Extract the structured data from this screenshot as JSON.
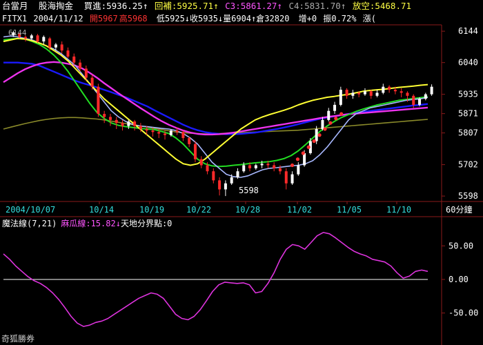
{
  "header": {
    "instrument": "台當月",
    "tool_name": "股海掏金",
    "bid_label": "買進:",
    "bid_value": "5936.25",
    "bid_arrow": "↑",
    "support_label": "回補:",
    "support_value": "5925.71",
    "support_arrow": "↑",
    "c3_label": "C3:",
    "c3_value": "5861.27",
    "c3_arrow": "↑",
    "c4_label": "C4:",
    "c4_value": "5831.70",
    "c4_arrow": "↑",
    "short_label": "放空:",
    "short_value": "5468.71",
    "extra": "漲("
  },
  "quote": {
    "symbol": "FITX1",
    "date": "2004/11/12",
    "open": "開5967",
    "high": "高5968",
    "low": "低5925",
    "low_arrow": "↓",
    "close": "收5935",
    "close_arrow": "↓",
    "volume": "量6904",
    "open_interest": "↑倉32820",
    "change": "增+0",
    "amplitude": "振0.72%",
    "extra": "漲("
  },
  "price_axis": [
    "6144",
    "6040",
    "5935",
    "5871",
    "5807",
    "5702",
    "5598"
  ],
  "low_annotation": "5598",
  "top_annotation": "6144",
  "date_axis": [
    "2004/10/07",
    "10/14",
    "10/19",
    "10/22",
    "10/28",
    "11/02",
    "11/05",
    "11/10"
  ],
  "period_label": "60分鐘",
  "indicator": {
    "name": "魔法線(7,21)",
    "value_label": "麻瓜線:15.82",
    "value_arrow": "↓",
    "boundary_label": "天地分界點:0",
    "axis": [
      "50.00",
      "0.00",
      "-50.00"
    ]
  },
  "footer": "奇狐勝券",
  "colors": {
    "bg": "#000000",
    "grid": "#8c1a1a",
    "up": "#ffffff",
    "down": "#ff2a2a",
    "ma_white": "#a8b8ff",
    "ma_green": "#22dd22",
    "ma_blue": "#1a1aff",
    "ma_magenta": "#ee33ee",
    "ma_olive": "#8a8a2a",
    "ma_yellow": "#ffff33",
    "osc": "#dd33dd",
    "text_white": "#ffffff",
    "text_yellow": "#ffff44",
    "text_green": "#33ff33",
    "text_magenta": "#ff55ff",
    "text_red": "#ff3333",
    "text_cyan": "#33dddd",
    "text_gray": "#aaaaaa"
  },
  "chart_data": [
    {
      "type": "candlestick",
      "title": "",
      "ylim": [
        5580,
        6165
      ],
      "price_ticks": [
        6144,
        6040,
        5935,
        5871,
        5807,
        5702,
        5598
      ],
      "candles": [
        [
          6130,
          6140,
          6125,
          6145
        ],
        [
          6135,
          6125,
          6120,
          6140
        ],
        [
          6125,
          6120,
          6110,
          6130
        ],
        [
          6120,
          6130,
          6115,
          6135
        ],
        [
          6130,
          6110,
          6105,
          6135
        ],
        [
          6110,
          6125,
          6100,
          6130
        ],
        [
          6120,
          6090,
          6080,
          6125
        ],
        [
          6090,
          6100,
          6080,
          6105
        ],
        [
          6100,
          6080,
          6070,
          6110
        ],
        [
          6080,
          6060,
          6055,
          6090
        ],
        [
          6060,
          6040,
          6030,
          6070
        ],
        [
          6040,
          6020,
          6010,
          6050
        ],
        [
          6020,
          5990,
          5980,
          6030
        ],
        [
          5990,
          5960,
          5950,
          6000
        ],
        [
          5960,
          5870,
          5860,
          5970
        ],
        [
          5870,
          5860,
          5840,
          5880
        ],
        [
          5860,
          5850,
          5830,
          5870
        ],
        [
          5850,
          5840,
          5820,
          5860
        ],
        [
          5840,
          5830,
          5815,
          5850
        ],
        [
          5830,
          5845,
          5820,
          5850
        ],
        [
          5845,
          5830,
          5815,
          5850
        ],
        [
          5830,
          5820,
          5810,
          5840
        ],
        [
          5820,
          5815,
          5800,
          5830
        ],
        [
          5815,
          5810,
          5795,
          5825
        ],
        [
          5810,
          5805,
          5790,
          5820
        ],
        [
          5805,
          5800,
          5785,
          5815
        ],
        [
          5800,
          5815,
          5795,
          5820
        ],
        [
          5815,
          5810,
          5800,
          5825
        ],
        [
          5810,
          5790,
          5780,
          5815
        ],
        [
          5790,
          5770,
          5760,
          5795
        ],
        [
          5770,
          5720,
          5710,
          5780
        ],
        [
          5720,
          5700,
          5690,
          5730
        ],
        [
          5700,
          5680,
          5670,
          5710
        ],
        [
          5680,
          5650,
          5640,
          5690
        ],
        [
          5650,
          5620,
          5600,
          5660
        ],
        [
          5620,
          5640,
          5598,
          5650
        ],
        [
          5640,
          5660,
          5635,
          5670
        ],
        [
          5660,
          5680,
          5655,
          5690
        ],
        [
          5680,
          5700,
          5675,
          5710
        ],
        [
          5700,
          5690,
          5680,
          5710
        ],
        [
          5690,
          5700,
          5685,
          5705
        ],
        [
          5700,
          5705,
          5690,
          5715
        ],
        [
          5705,
          5700,
          5690,
          5715
        ],
        [
          5700,
          5690,
          5680,
          5710
        ],
        [
          5690,
          5680,
          5670,
          5700
        ],
        [
          5680,
          5640,
          5620,
          5690
        ],
        [
          5640,
          5670,
          5635,
          5680
        ],
        [
          5670,
          5700,
          5665,
          5710
        ],
        [
          5700,
          5740,
          5695,
          5750
        ],
        [
          5740,
          5780,
          5735,
          5790
        ],
        [
          5780,
          5820,
          5770,
          5830
        ],
        [
          5820,
          5850,
          5815,
          5860
        ],
        [
          5850,
          5880,
          5845,
          5890
        ],
        [
          5880,
          5900,
          5870,
          5910
        ],
        [
          5900,
          5950,
          5895,
          5960
        ],
        [
          5950,
          5930,
          5920,
          5955
        ],
        [
          5930,
          5940,
          5920,
          5950
        ],
        [
          5940,
          5935,
          5925,
          5945
        ],
        [
          5935,
          5945,
          5930,
          5955
        ],
        [
          5945,
          5930,
          5920,
          5950
        ],
        [
          5930,
          5940,
          5925,
          5950
        ],
        [
          5940,
          5960,
          5935,
          5970
        ],
        [
          5960,
          5950,
          5940,
          5965
        ],
        [
          5950,
          5945,
          5935,
          5960
        ],
        [
          5945,
          5940,
          5925,
          5955
        ],
        [
          5940,
          5930,
          5910,
          5945
        ],
        [
          5930,
          5900,
          5890,
          5935
        ],
        [
          5900,
          5920,
          5895,
          5925
        ],
        [
          5920,
          5935,
          5915,
          5940
        ],
        [
          5935,
          5960,
          5930,
          5968
        ]
      ],
      "moving_averages": {
        "white": [
          6125,
          6128,
          6125,
          6120,
          6115,
          6105,
          6095,
          6085,
          6070,
          6050,
          6030,
          6000,
          5970,
          5940,
          5910,
          5880,
          5860,
          5845,
          5835,
          5830,
          5828,
          5825,
          5822,
          5820,
          5815,
          5805,
          5790,
          5770,
          5740,
          5710,
          5690,
          5670,
          5662,
          5660,
          5665,
          5675,
          5685,
          5690,
          5692,
          5695,
          5698,
          5700,
          5705,
          5715,
          5735,
          5760,
          5790,
          5820,
          5850,
          5870,
          5880,
          5890,
          5895,
          5900,
          5905,
          5910,
          5915,
          5918,
          5920,
          5925
        ],
        "green": [
          6115,
          6118,
          6120,
          6118,
          6110,
          6100,
          6085,
          6065,
          6040,
          6010,
          5975,
          5940,
          5905,
          5875,
          5855,
          5840,
          5832,
          5828,
          5825,
          5822,
          5820,
          5818,
          5812,
          5805,
          5790,
          5770,
          5745,
          5720,
          5705,
          5698,
          5696,
          5697,
          5700,
          5702,
          5705,
          5708,
          5710,
          5712,
          5716,
          5722,
          5732,
          5748,
          5768,
          5790,
          5812,
          5830,
          5845,
          5858,
          5868,
          5878,
          5886,
          5893,
          5900,
          5905,
          5910,
          5915,
          5918,
          5921,
          5924,
          5927
        ],
        "yellow": [
          6110,
          6115,
          6120,
          6118,
          6112,
          6105,
          6095,
          6080,
          6065,
          6045,
          6020,
          5995,
          5970,
          5945,
          5920,
          5900,
          5880,
          5860,
          5840,
          5820,
          5800,
          5780,
          5760,
          5740,
          5720,
          5705,
          5700,
          5705,
          5720,
          5740,
          5760,
          5780,
          5800,
          5820,
          5835,
          5850,
          5860,
          5868,
          5875,
          5882,
          5890,
          5900,
          5908,
          5915,
          5920,
          5925,
          5928,
          5932,
          5935,
          5940,
          5945,
          5948,
          5950,
          5952,
          5955,
          5958,
          5960,
          5962,
          5965,
          5967
        ],
        "blue": [
          6040,
          6040,
          6040,
          6038,
          6036,
          6030,
          6020,
          6010,
          6000,
          5990,
          5980,
          5972,
          5965,
          5958,
          5950,
          5942,
          5933,
          5925,
          5915,
          5905,
          5895,
          5882,
          5870,
          5858,
          5846,
          5834,
          5824,
          5816,
          5810,
          5806,
          5804,
          5803,
          5803,
          5804,
          5806,
          5808,
          5812,
          5816,
          5820,
          5825,
          5830,
          5836,
          5842,
          5848,
          5854,
          5858,
          5862,
          5866,
          5870,
          5874,
          5877,
          5880,
          5883,
          5886,
          5889,
          5892,
          5895,
          5898,
          5900,
          5903
        ],
        "magenta": [
          5975,
          5990,
          6005,
          6018,
          6028,
          6036,
          6040,
          6042,
          6040,
          6036,
          6030,
          6020,
          6006,
          5990,
          5972,
          5955,
          5938,
          5922,
          5906,
          5890,
          5875,
          5860,
          5846,
          5834,
          5824,
          5815,
          5808,
          5804,
          5802,
          5802,
          5803,
          5805,
          5808,
          5812,
          5816,
          5820,
          5824,
          5828,
          5832,
          5836,
          5840,
          5844,
          5848,
          5852,
          5856,
          5860,
          5863,
          5866,
          5869,
          5871,
          5873,
          5875,
          5877,
          5879,
          5881,
          5883,
          5885,
          5887,
          5889,
          5891
        ],
        "olive": [
          5820,
          5826,
          5832,
          5838,
          5843,
          5848,
          5852,
          5855,
          5857,
          5858,
          5858,
          5857,
          5855,
          5853,
          5850,
          5846,
          5842,
          5838,
          5834,
          5830,
          5826,
          5822,
          5818,
          5814,
          5810,
          5808,
          5806,
          5805,
          5804,
          5804,
          5805,
          5806,
          5807,
          5808,
          5809,
          5810,
          5811,
          5812,
          5813,
          5814,
          5815,
          5816,
          5818,
          5820,
          5822,
          5824,
          5826,
          5828,
          5830,
          5832,
          5834,
          5836,
          5838,
          5840,
          5842,
          5844,
          5846,
          5848,
          5850,
          5852
        ]
      },
      "signal_dots": [
        5700,
        5720,
        5740,
        5760,
        5780,
        5800,
        5820,
        5840,
        5855,
        5870
      ]
    },
    {
      "type": "line",
      "title": "魔法線(7,21)",
      "ylim": [
        -75,
        75
      ],
      "y_ticks": [
        50,
        0,
        -50
      ],
      "series": [
        {
          "name": "麻瓜線",
          "values": [
            38,
            30,
            20,
            12,
            4,
            -2,
            -6,
            -12,
            -20,
            -30,
            -42,
            -55,
            -65,
            -70,
            -68,
            -64,
            -62,
            -58,
            -52,
            -46,
            -40,
            -34,
            -28,
            -24,
            -20,
            -22,
            -28,
            -40,
            -52,
            -58,
            -60,
            -55,
            -45,
            -32,
            -18,
            -8,
            -4,
            -5,
            -6,
            -5,
            -8,
            -20,
            -18,
            -6,
            10,
            30,
            45,
            52,
            50,
            45,
            55,
            65,
            70,
            68,
            62,
            55,
            48,
            42,
            38,
            35,
            30,
            28,
            26,
            20,
            10,
            2,
            5,
            12,
            14,
            12
          ]
        }
      ]
    }
  ]
}
